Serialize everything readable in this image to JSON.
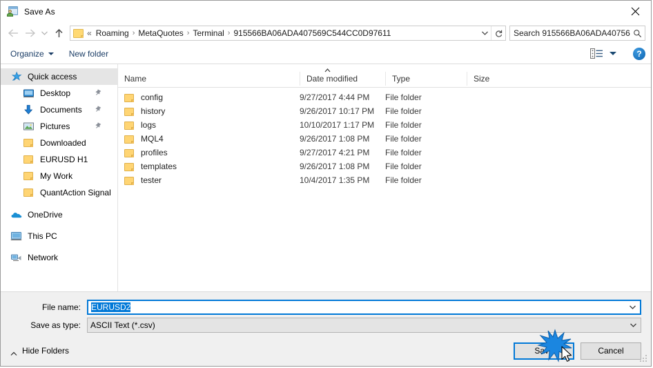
{
  "window": {
    "title": "Save As",
    "icon": "save-as-icon",
    "close_label": "✕"
  },
  "nav": {
    "back": "←",
    "forward": "→",
    "recent": "⌄",
    "up": "↑",
    "refresh": "↻",
    "breadcrumb": {
      "overflow": "«",
      "separator": "›",
      "items": [
        "Roaming",
        "MetaQuotes",
        "Terminal",
        "915566BA06ADA407569C544CC0D97611"
      ]
    }
  },
  "search": {
    "placeholder": "Search 915566BA06ADA40756...",
    "icon": "search-icon"
  },
  "toolbar": {
    "organize": "Organize",
    "new_folder": "New folder",
    "view_icon": "change-view-icon",
    "help": "?"
  },
  "sidebar": {
    "items": [
      {
        "label": "Quick access",
        "icon": "quick-access-star-icon",
        "level": "root",
        "selected": true,
        "pinned": false
      },
      {
        "label": "Desktop",
        "icon": "desktop-icon",
        "level": "child",
        "selected": false,
        "pinned": true
      },
      {
        "label": "Documents",
        "icon": "documents-icon",
        "level": "child",
        "selected": false,
        "pinned": true
      },
      {
        "label": "Pictures",
        "icon": "pictures-icon",
        "level": "child",
        "selected": false,
        "pinned": true
      },
      {
        "label": "Downloaded",
        "icon": "folder-icon",
        "level": "child",
        "selected": false,
        "pinned": false
      },
      {
        "label": "EURUSD H1",
        "icon": "folder-icon",
        "level": "child",
        "selected": false,
        "pinned": false
      },
      {
        "label": "My Work",
        "icon": "folder-icon",
        "level": "child",
        "selected": false,
        "pinned": false
      },
      {
        "label": "QuantAction Signal",
        "icon": "folder-icon",
        "level": "child",
        "selected": false,
        "pinned": false
      },
      {
        "label": "OneDrive",
        "icon": "onedrive-cloud-icon",
        "level": "root",
        "selected": false,
        "pinned": false
      },
      {
        "label": "This PC",
        "icon": "this-pc-icon",
        "level": "root",
        "selected": false,
        "pinned": false
      },
      {
        "label": "Network",
        "icon": "network-icon",
        "level": "root",
        "selected": false,
        "pinned": false
      }
    ]
  },
  "filelist": {
    "columns": [
      "Name",
      "Date modified",
      "Type",
      "Size"
    ],
    "sort_indicator": "ascending",
    "rows": [
      {
        "name": "config",
        "date": "9/27/2017 4:44 PM",
        "type": "File folder",
        "size": ""
      },
      {
        "name": "history",
        "date": "9/26/2017 10:17 PM",
        "type": "File folder",
        "size": ""
      },
      {
        "name": "logs",
        "date": "10/10/2017 1:17 PM",
        "type": "File folder",
        "size": ""
      },
      {
        "name": "MQL4",
        "date": "9/26/2017 1:08 PM",
        "type": "File folder",
        "size": ""
      },
      {
        "name": "profiles",
        "date": "9/27/2017 4:21 PM",
        "type": "File folder",
        "size": ""
      },
      {
        "name": "templates",
        "date": "9/26/2017 1:08 PM",
        "type": "File folder",
        "size": ""
      },
      {
        "name": "tester",
        "date": "10/4/2017 1:35 PM",
        "type": "File folder",
        "size": ""
      }
    ]
  },
  "form": {
    "filename_label": "File name:",
    "filename_value": "EURUSD2",
    "savetype_label": "Save as type:",
    "savetype_value": "ASCII Text (*.csv)"
  },
  "footer": {
    "hide_folders": "Hide Folders",
    "save": "Save",
    "cancel": "Cancel"
  },
  "colors": {
    "accent": "#0078d7",
    "folder": "#ffd574",
    "toolbar_text": "#1b3d66"
  }
}
